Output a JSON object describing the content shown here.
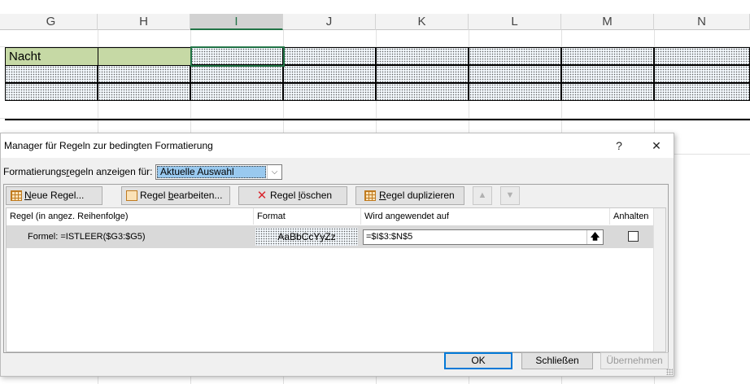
{
  "sheet": {
    "columns": [
      "G",
      "H",
      "I",
      "J",
      "K",
      "L",
      "M",
      "N"
    ],
    "active_column": "I",
    "cell_nacht": "Nacht"
  },
  "dialog": {
    "title": "Manager für Regeln zur bedingten Formatierung",
    "help": "?",
    "close": "✕",
    "show_label_pre": "Formatierungs",
    "show_label_u": "r",
    "show_label_post": "egeln anzeigen für:",
    "show_for_value": "Aktuelle Auswahl",
    "toolbar": {
      "new_rule_u": "N",
      "new_rule_rest": "eue Regel...",
      "edit_rule_pre": "Regel ",
      "edit_rule_u": "b",
      "edit_rule_post": "earbeiten...",
      "delete_rule_pre": "Regel ",
      "delete_rule_u": "l",
      "delete_rule_post": "öschen",
      "duplicate_rule_pre": "",
      "duplicate_rule_u": "R",
      "duplicate_rule_post": "egel duplizieren",
      "move_up": "▲",
      "move_down": "▼"
    },
    "columns": {
      "rule": "Regel (in angez. Reihenfolge)",
      "format": "Format",
      "applies_to": "Wird angewendet auf",
      "stop": "Anhalten"
    },
    "rules": [
      {
        "rule": "Formel: =ISTLEER($G3:$G5)",
        "format_preview": "AaBbCcYyZz",
        "applies_to": "=$I$3:$N$5",
        "stop_if_true": false
      }
    ],
    "footer": {
      "ok": "OK",
      "close": "Schließen",
      "apply": "Übernehmen"
    }
  },
  "colors": {
    "selection": "#217346",
    "highlight": "#99c9ef",
    "nacht_fill": "#c6d9a5"
  }
}
